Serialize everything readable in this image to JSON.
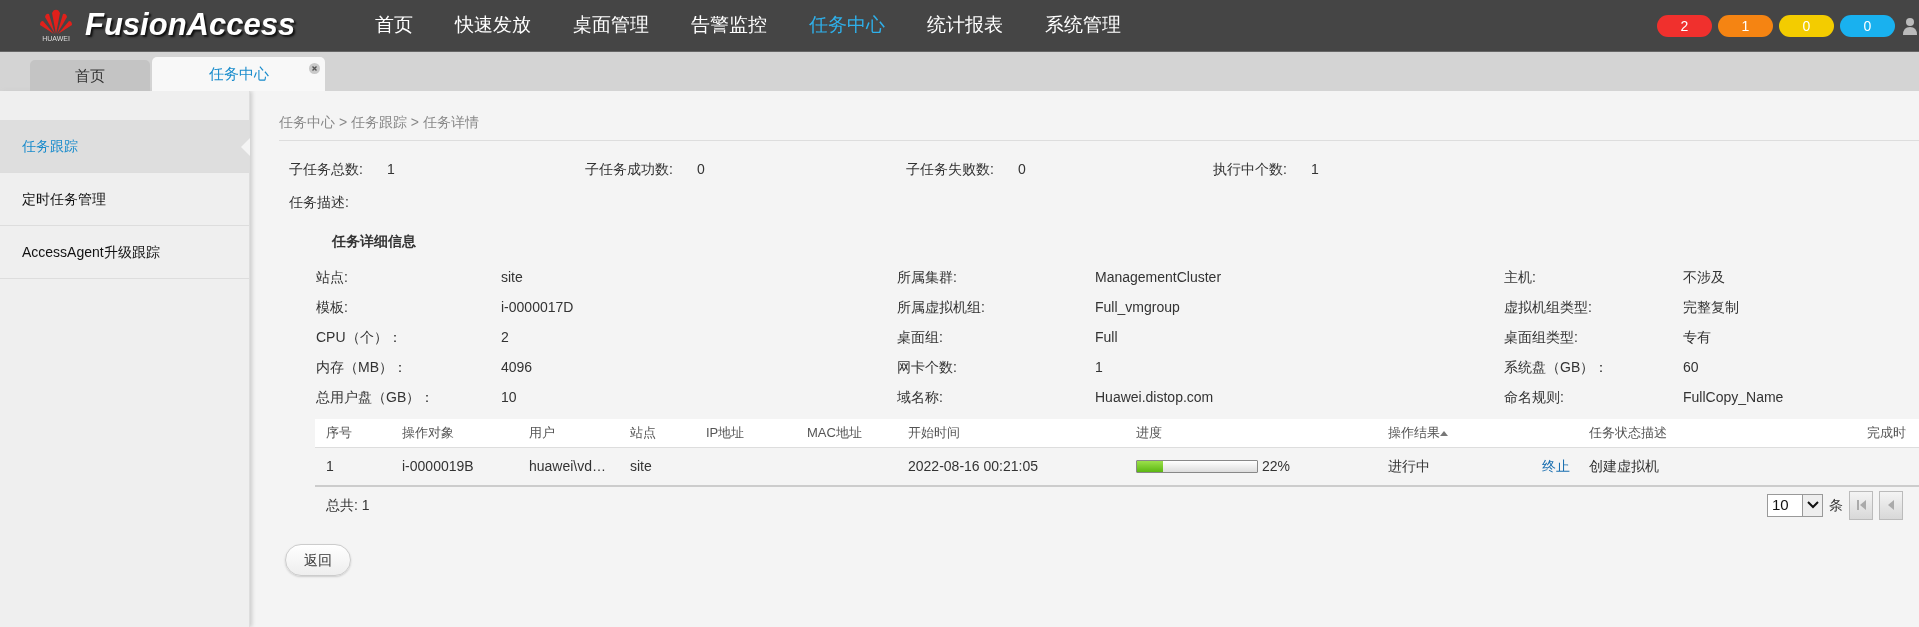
{
  "header": {
    "logo": {
      "caption": "HUAWEI",
      "title": "FusionAccess"
    },
    "nav": [
      {
        "label": "首页",
        "selected": false
      },
      {
        "label": "快速发放",
        "selected": false
      },
      {
        "label": "桌面管理",
        "selected": false
      },
      {
        "label": "告警监控",
        "selected": false
      },
      {
        "label": "任务中心",
        "selected": true
      },
      {
        "label": "统计报表",
        "selected": false
      },
      {
        "label": "系统管理",
        "selected": false
      }
    ],
    "alarm_badges": [
      {
        "count": "2",
        "color": "#f0302d"
      },
      {
        "count": "1",
        "color": "#f58412"
      },
      {
        "count": "0",
        "color": "#f3cc00"
      },
      {
        "count": "0",
        "color": "#19b1ef"
      }
    ]
  },
  "tabs": [
    {
      "label": "首页",
      "selected": false,
      "closable": false
    },
    {
      "label": "任务中心",
      "selected": true,
      "closable": true
    }
  ],
  "sidebar": {
    "items": [
      {
        "label": "任务跟踪",
        "selected": true
      },
      {
        "label": "定时任务管理",
        "selected": false
      },
      {
        "label": "AccessAgent升级跟踪",
        "selected": false
      }
    ]
  },
  "breadcrumb": "任务中心 > 任务跟踪 > 任务详情",
  "summary": [
    {
      "label": "子任务总数:",
      "value": "1"
    },
    {
      "label": "子任务成功数:",
      "value": "0"
    },
    {
      "label": "子任务失败数:",
      "value": "0"
    },
    {
      "label": "执行中个数:",
      "value": "1"
    }
  ],
  "description": {
    "label": "任务描述:"
  },
  "details": {
    "title": "任务详细信息",
    "fields": [
      {
        "label": "站点:",
        "value": "site"
      },
      {
        "label": "所属集群:",
        "value": "ManagementCluster"
      },
      {
        "label": "主机:",
        "value": "不涉及"
      },
      {
        "label": "模板:",
        "value": "i-0000017D"
      },
      {
        "label": "所属虚拟机组:",
        "value": "Full_vmgroup"
      },
      {
        "label": "虚拟机组类型:",
        "value": "完整复制"
      },
      {
        "label": "CPU（个）：",
        "value": "2"
      },
      {
        "label": "桌面组:",
        "value": "Full"
      },
      {
        "label": "桌面组类型:",
        "value": "专有"
      },
      {
        "label": "内存（MB）：",
        "value": "4096"
      },
      {
        "label": "网卡个数:",
        "value": "1"
      },
      {
        "label": "系统盘（GB）：",
        "value": "60"
      },
      {
        "label": "总用户盘（GB）：",
        "value": "10"
      },
      {
        "label": "域名称:",
        "value": "Huawei.distop.com"
      },
      {
        "label": "命名规则:",
        "value": "FullCopy_Name"
      }
    ]
  },
  "table": {
    "columns": [
      {
        "label": "序号",
        "sorted": false
      },
      {
        "label": "操作对象",
        "sorted": false
      },
      {
        "label": "用户",
        "sorted": false
      },
      {
        "label": "站点",
        "sorted": false
      },
      {
        "label": "IP地址",
        "sorted": false
      },
      {
        "label": "MAC地址",
        "sorted": false
      },
      {
        "label": "开始时间",
        "sorted": false
      },
      {
        "label": "进度",
        "sorted": false
      },
      {
        "label": "操作结果",
        "sorted": true
      },
      {
        "label": "任务状态描述",
        "sorted": false
      },
      {
        "label": "完成时",
        "sorted": false
      }
    ],
    "rows": [
      {
        "index": "1",
        "target": "i-0000019B",
        "user": "huawei\\vd…",
        "site": "site",
        "start_time": "2022-08-16 00:21:05",
        "level": 0.22,
        "progress_text": "22%",
        "result": "进行中",
        "action": "终止",
        "status": "创建虚拟机"
      }
    ]
  },
  "total": "总共: 1",
  "pager": {
    "page_size": "10",
    "unit": "条",
    "buttons": [
      {
        "kind": "first",
        "disabled": true
      },
      {
        "kind": "prev",
        "disabled": true
      }
    ]
  },
  "back_button": "返回"
}
